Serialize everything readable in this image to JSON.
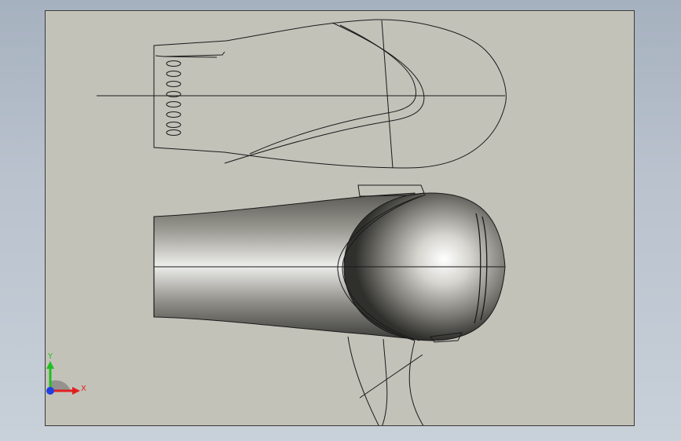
{
  "viewport": {
    "background": "#c3c2b9",
    "border": "#3a3a3a"
  },
  "triad": {
    "x_label": "X",
    "y_label": "Y",
    "x_color": "#e02020",
    "y_color": "#20c020",
    "z_color": "#2040e0"
  },
  "model": {
    "body_shading": "metallic-gray",
    "line_color": "#1a1a1a"
  }
}
